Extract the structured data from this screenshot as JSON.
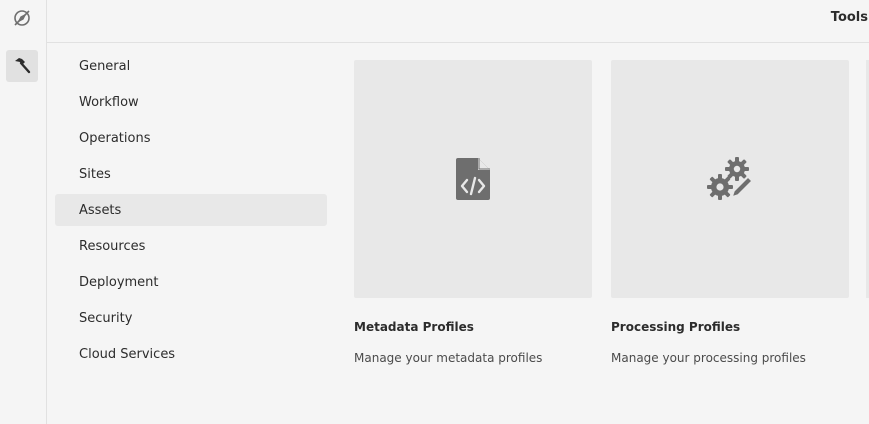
{
  "rail": {
    "navigation_icon": "compass-off-icon",
    "tools_icon": "hammer-icon"
  },
  "header": {
    "title": "Tools"
  },
  "subnav": {
    "items": [
      {
        "label": "General"
      },
      {
        "label": "Workflow"
      },
      {
        "label": "Operations"
      },
      {
        "label": "Sites"
      },
      {
        "label": "Assets"
      },
      {
        "label": "Resources"
      },
      {
        "label": "Deployment"
      },
      {
        "label": "Security"
      },
      {
        "label": "Cloud Services"
      }
    ],
    "selected": "Assets"
  },
  "cards": [
    {
      "title": "Metadata Profiles",
      "description": "Manage your metadata profiles",
      "icon": "code-file-icon"
    },
    {
      "title": "Processing Profiles",
      "description": "Manage your processing profiles",
      "icon": "gears-pencil-icon"
    }
  ],
  "colors": {
    "background": "#f5f5f5",
    "selected": "#e8e8e8",
    "icon": "#6e6e6e"
  }
}
